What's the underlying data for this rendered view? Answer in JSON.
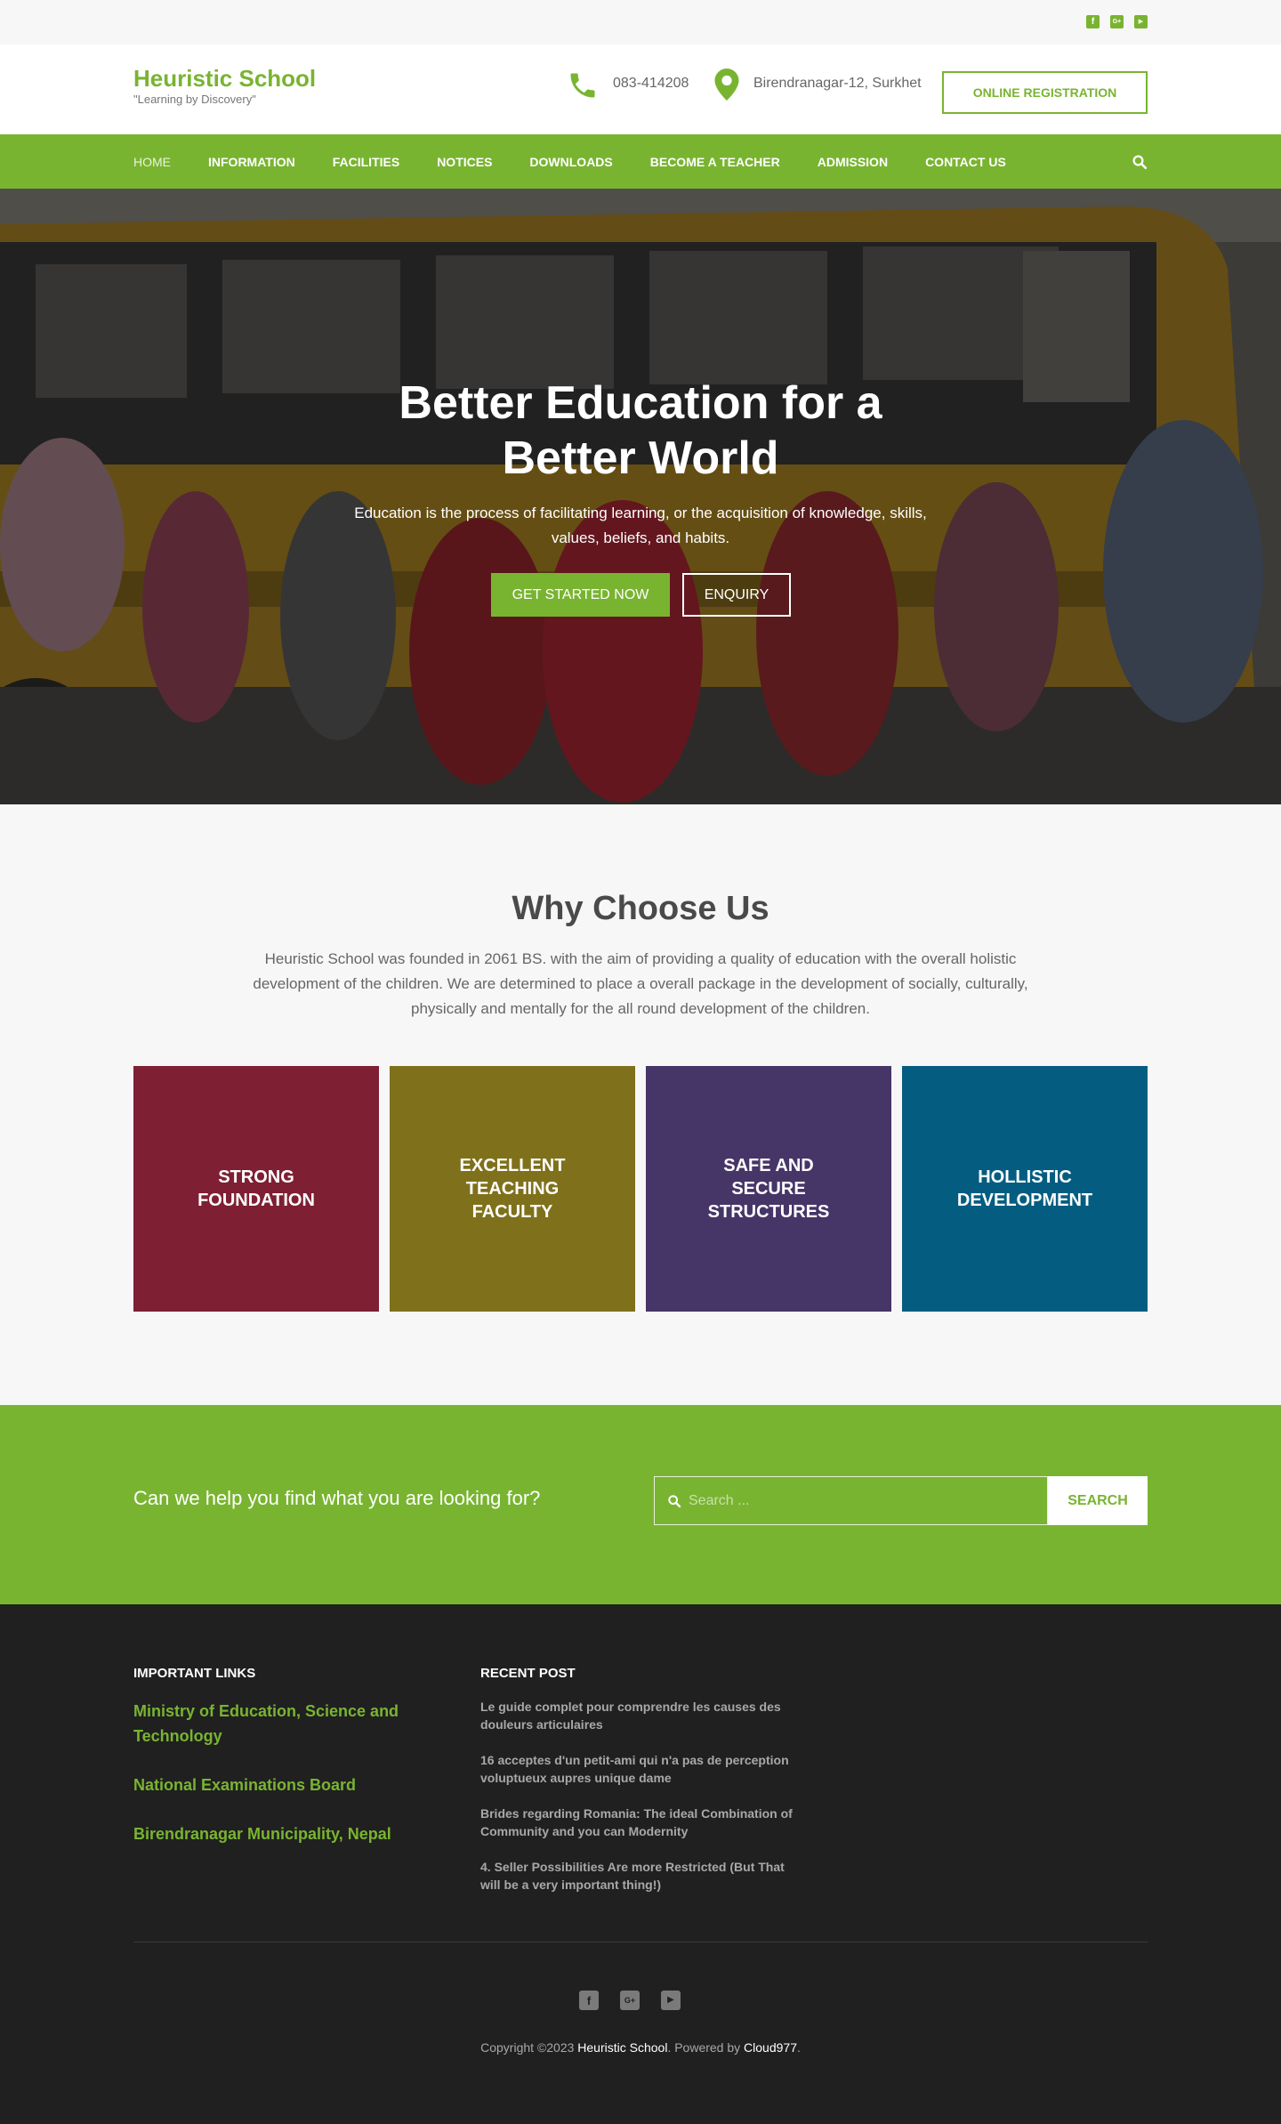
{
  "topbar": {
    "socials": [
      {
        "icon": "facebook-icon",
        "glyph": "f"
      },
      {
        "icon": "google-plus-icon",
        "glyph": "G+"
      },
      {
        "icon": "youtube-icon",
        "glyph": "▶"
      }
    ]
  },
  "header": {
    "site_title": "Heuristic School",
    "tagline": "\"Learning by Discovery\"",
    "phone": "083-414208",
    "address": "Birendranagar-12, Surkhet",
    "registration_button": "ONLINE REGISTRATION",
    "accent_color": "#79b431"
  },
  "nav": {
    "items": [
      {
        "label": "HOME",
        "active": true
      },
      {
        "label": "INFORMATION"
      },
      {
        "label": "FACILITIES"
      },
      {
        "label": "NOTICES"
      },
      {
        "label": "DOWNLOADS"
      },
      {
        "label": "BECOME A TEACHER"
      },
      {
        "label": "ADMISSION"
      },
      {
        "label": "CONTACT US"
      }
    ]
  },
  "hero": {
    "title": "Better Education for a Better World",
    "subtitle": "Education is the process of facilitating learning, or the acquisition of knowledge, skills, values, beliefs, and habits.",
    "primary_button": "GET STARTED NOW",
    "secondary_button": "ENQUIRY"
  },
  "why": {
    "title": "Why Choose Us",
    "description": "Heuristic School was founded in 2061 BS. with the aim of providing a quality of education with the overall holistic development of the children. We are determined to place a overall package in the development of  socially, culturally, physically and mentally for the  all round development of the children.",
    "cards": [
      {
        "label": "STRONG FOUNDATION",
        "color": "#7e1f33"
      },
      {
        "label": "EXCELLENT TEACHING FACULTY",
        "color": "#7f701b"
      },
      {
        "label": "SAFE AND SECURE STRUCTURES",
        "color": "#463567"
      },
      {
        "label": "HOLLISTIC DEVELOPMENT",
        "color": "#045d80"
      }
    ]
  },
  "help": {
    "question": "Can we help you find what you are looking for?",
    "search_placeholder": "Search ...",
    "search_value": "",
    "search_button": "SEARCH"
  },
  "footer": {
    "links_heading": "IMPORTANT LINKS",
    "links": [
      "Ministry of Education, Science and Technology",
      "National Examinations Board",
      "Birendranagar Municipality, Nepal"
    ],
    "posts_heading": "RECENT POST",
    "posts": [
      "Le guide complet pour comprendre les causes des douleurs articulaires",
      "16 acceptes d'un petit-ami qui n'a pas de perception voluptueux aupres unique dame",
      "Brides regarding Romania: The ideal Combination of Community and you can Modernity",
      "4. Seller Possibilities Are more Restricted (But That will be a very important thing!)"
    ],
    "socials": [
      {
        "icon": "facebook-icon",
        "glyph": "f"
      },
      {
        "icon": "google-plus-icon",
        "glyph": "G+"
      },
      {
        "icon": "youtube-icon",
        "glyph": "▶"
      }
    ],
    "copyright_prefix": "Copyright ©2023 ",
    "copyright_site": "Heuristic School",
    "copyright_mid": ". Powered by ",
    "copyright_vendor": "Cloud977",
    "copyright_end": "."
  }
}
